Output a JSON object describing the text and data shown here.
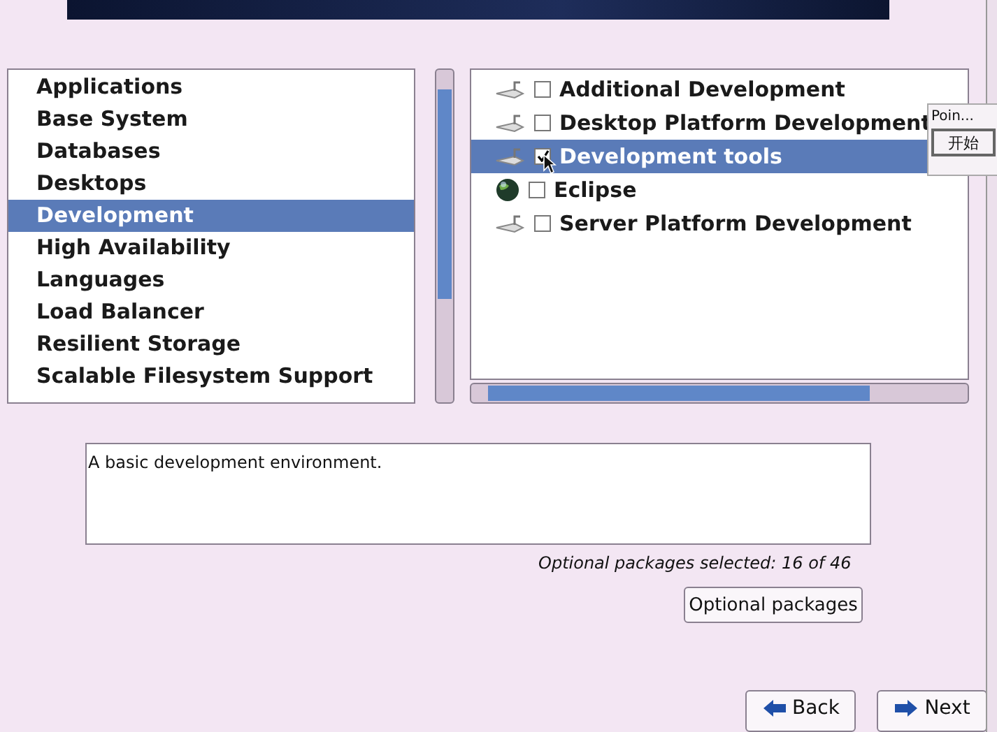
{
  "categories": [
    {
      "label": "Applications",
      "selected": false
    },
    {
      "label": "Base System",
      "selected": false
    },
    {
      "label": "Databases",
      "selected": false
    },
    {
      "label": "Desktops",
      "selected": false
    },
    {
      "label": "Development",
      "selected": true
    },
    {
      "label": "High Availability",
      "selected": false
    },
    {
      "label": "Languages",
      "selected": false
    },
    {
      "label": "Load Balancer",
      "selected": false
    },
    {
      "label": "Resilient Storage",
      "selected": false
    },
    {
      "label": "Scalable Filesystem Support",
      "selected": false
    }
  ],
  "groups": [
    {
      "label": "Additional Development",
      "kind": "tool",
      "checked": false,
      "selected": false
    },
    {
      "label": "Desktop Platform Development",
      "kind": "tool",
      "checked": false,
      "selected": false
    },
    {
      "label": "Development tools",
      "kind": "tool",
      "checked": true,
      "selected": true
    },
    {
      "label": "Eclipse",
      "kind": "globe",
      "checked": false,
      "selected": false
    },
    {
      "label": "Server Platform Development",
      "kind": "tool",
      "checked": false,
      "selected": false
    }
  ],
  "popup": {
    "title": "Poin...",
    "button": "开始"
  },
  "description": "A basic development environment.",
  "selection_summary": "Optional packages selected: 16 of 46",
  "optional_button": "Optional packages",
  "nav_buttons": [
    {
      "label": "Back",
      "kind": "back"
    },
    {
      "label": "Next",
      "kind": "next"
    }
  ]
}
